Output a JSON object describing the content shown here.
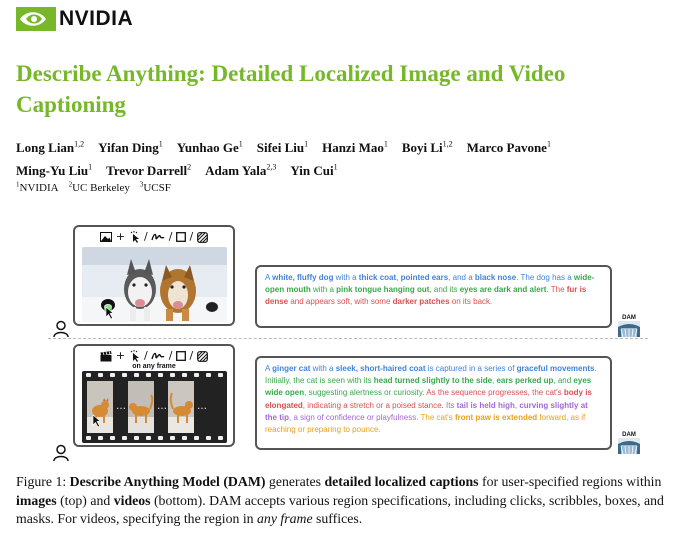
{
  "header": {
    "logo_text": "NVIDIA",
    "brand_color": "#76b82a"
  },
  "title": "Describe Anything: Detailed Localized Image and Video Captioning",
  "authors": [
    {
      "name": "Long Lian",
      "sup": "1,2"
    },
    {
      "name": "Yifan Ding",
      "sup": "1"
    },
    {
      "name": "Yunhao Ge",
      "sup": "1"
    },
    {
      "name": "Sifei Liu",
      "sup": "1"
    },
    {
      "name": "Hanzi Mao",
      "sup": "1"
    },
    {
      "name": "Boyi Li",
      "sup": "1,2"
    },
    {
      "name": "Marco Pavone",
      "sup": "1"
    },
    {
      "name": "Ming-Yu Liu",
      "sup": "1"
    },
    {
      "name": "Trevor Darrell",
      "sup": "2"
    },
    {
      "name": "Adam Yala",
      "sup": "2,3"
    },
    {
      "name": "Yin Cui",
      "sup": "1"
    }
  ],
  "affiliations": [
    {
      "sup": "1",
      "name": "NVIDIA"
    },
    {
      "sup": "2",
      "name": "UC Berkeley"
    },
    {
      "sup": "3",
      "name": "UCSF"
    }
  ],
  "figure": {
    "video_panel_label": "on any frame",
    "model_icon_label": "DAM",
    "image_caption_segments": [
      {
        "t": "A ",
        "c": "blue"
      },
      {
        "t": "white, fluffy dog",
        "c": "blue",
        "b": true
      },
      {
        "t": " with a ",
        "c": "blue"
      },
      {
        "t": "thick coat",
        "c": "blue",
        "b": true
      },
      {
        "t": ", ",
        "c": "blue"
      },
      {
        "t": "pointed ears",
        "c": "blue",
        "b": true
      },
      {
        "t": ", and a ",
        "c": "blue"
      },
      {
        "t": "black nose",
        "c": "blue",
        "b": true
      },
      {
        "t": ". The dog has a ",
        "c": "blue"
      },
      {
        "t": "wide-open mouth",
        "c": "green",
        "b": true
      },
      {
        "t": " with a ",
        "c": "green"
      },
      {
        "t": "pink tongue hanging out",
        "c": "green",
        "b": true
      },
      {
        "t": ", and its ",
        "c": "green"
      },
      {
        "t": "eyes are dark and alert",
        "c": "green",
        "b": true
      },
      {
        "t": ". ",
        "c": "green"
      },
      {
        "t": "The ",
        "c": "red"
      },
      {
        "t": "fur is dense",
        "c": "red",
        "b": true
      },
      {
        "t": " and appears soft, with some ",
        "c": "red"
      },
      {
        "t": "darker patches",
        "c": "red",
        "b": true
      },
      {
        "t": " on its back.",
        "c": "red"
      }
    ],
    "video_caption_segments": [
      {
        "t": "A ",
        "c": "blue"
      },
      {
        "t": "ginger cat",
        "c": "blue",
        "b": true
      },
      {
        "t": " with a ",
        "c": "blue"
      },
      {
        "t": "sleek, short-haired coat",
        "c": "blue",
        "b": true
      },
      {
        "t": " is captured in a series of ",
        "c": "blue"
      },
      {
        "t": "graceful movements",
        "c": "blue",
        "b": true
      },
      {
        "t": ". Initially, the cat is seen with its ",
        "c": "green"
      },
      {
        "t": "head turned slightly to the side",
        "c": "green",
        "b": true
      },
      {
        "t": ", ",
        "c": "green"
      },
      {
        "t": "ears perked up",
        "c": "green",
        "b": true
      },
      {
        "t": ", and ",
        "c": "green"
      },
      {
        "t": "eyes wide open",
        "c": "green",
        "b": true
      },
      {
        "t": ", suggesting alertness or curiosity. ",
        "c": "green"
      },
      {
        "t": "As the sequence progresses, the cat's ",
        "c": "red"
      },
      {
        "t": "body is elongated",
        "c": "red",
        "b": true
      },
      {
        "t": ", indicating a stretch or a poised stance. ",
        "c": "red"
      },
      {
        "t": "Its ",
        "c": "purple"
      },
      {
        "t": "tail is held high",
        "c": "purple",
        "b": true
      },
      {
        "t": ", ",
        "c": "purple"
      },
      {
        "t": "curving slightly at the tip",
        "c": "purple",
        "b": true
      },
      {
        "t": ", a sign of confidence or playfulness. ",
        "c": "purple"
      },
      {
        "t": "The cat's ",
        "c": "orange"
      },
      {
        "t": "front paw is extended",
        "c": "orange",
        "b": true
      },
      {
        "t": " forward, as if reaching or preparing to pounce.",
        "c": "orange"
      }
    ],
    "caption": {
      "label": "Figure 1:",
      "model_name": "Describe Anything Model (DAM)",
      "t1": " generates ",
      "b1": "detailed localized captions",
      "t2": " for user-specified regions within ",
      "b2": "images",
      "t3": " (top) and ",
      "b3": "videos",
      "t4": " (bottom). DAM accepts various region specifications, including clicks, scribbles, boxes, and masks. For videos, specifying the region in ",
      "i1": "any frame",
      "t5": " suffices."
    }
  },
  "colors": {
    "blue": "#3f83dc",
    "green": "#39a84a",
    "red": "#d85050",
    "purple": "#a468d8",
    "orange": "#e9a01b"
  }
}
